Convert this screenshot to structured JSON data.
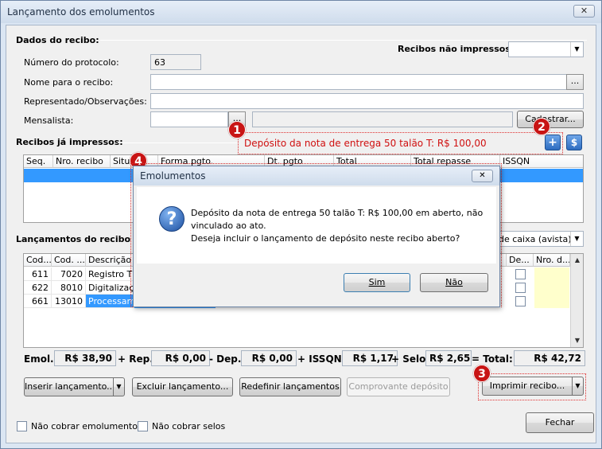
{
  "window": {
    "title": "Lançamento dos emolumentos",
    "close_glyph": "✕"
  },
  "dados_recibo": {
    "section_title": "Dados do recibo:",
    "nao_impressos_label": "Recibos não impressos:",
    "nao_impressos_value": "",
    "protocolo_label": "Número do protocolo:",
    "protocolo_value": "63",
    "nome_label": "Nome para o recibo:",
    "nome_value": "",
    "representado_label": "Representado/Observações:",
    "representado_value": "",
    "mensalista_label": "Mensalista:",
    "mensalista_value": "",
    "mensalista_nome_value": "",
    "ellipsis": "...",
    "cadastrar_label": "Cadastrar..."
  },
  "recibos_impressos": {
    "section_title": "Recibos já impressos:",
    "deposit_notice": "Depósito da nota de entrega 50 talão T: R$ 100,00",
    "add_glyph": "+",
    "money_glyph": "$",
    "columns": [
      "Seq.",
      "Nro. recibo",
      "Situ",
      "Forma pgto.",
      "Dt. pgto",
      "Total",
      "Total repasse",
      "ISSQN"
    ]
  },
  "lancamentos": {
    "section_title": "Lançamentos do recibo (em",
    "forma_pgto_value": "de caixa (avista)",
    "columns": [
      "Cod....",
      "Cod. ...",
      "Descrição",
      "De...",
      "Nro. d..."
    ],
    "rows": [
      {
        "cod1": "611",
        "cod2": "7020",
        "descricao": "Registro TD"
      },
      {
        "cod1": "622",
        "cod2": "8010",
        "descricao": "Digitalização"
      },
      {
        "cod1": "661",
        "cod2": "13010",
        "descricao": "Processame"
      }
    ]
  },
  "totals": {
    "emol_label": "Emol.:",
    "emol_value": "R$ 38,90",
    "rep_label": "+ Rep.:",
    "rep_value": "R$ 0,00",
    "dep_label": "- Dep.:",
    "dep_value": "R$ 0,00",
    "issqn_label": "+ ISSQN:",
    "issqn_value": "R$ 1,17",
    "selo_label": "+ Selo:",
    "selo_value": "R$ 2,65",
    "total_label": "= Total:",
    "total_value": "R$ 42,72"
  },
  "actions": {
    "inserir": "Inserir lançamento...",
    "excluir": "Excluir lançamento...",
    "redefinir": "Redefinir lançamentos",
    "comprovante": "Comprovante depósito",
    "imprimir": "Imprimir recibo...",
    "nao_cobrar_emol": "Não cobrar emolumentos",
    "nao_cobrar_selos": "Não cobrar selos",
    "fechar": "Fechar"
  },
  "badges": {
    "b1": "1",
    "b2": "2",
    "b3": "3",
    "b4": "4"
  },
  "dialog": {
    "title": "Emolumentos",
    "icon_glyph": "?",
    "line1": " Depósito da nota de entrega 50 talão T: R$ 100,00 em aberto, não",
    "line2": "vinculado ao ato.",
    "line3": "Deseja incluir o lançamento de depósito neste recibo aberto?",
    "yes": "Sim",
    "no": "Não"
  },
  "colors": {
    "deposit_text": "#d01010",
    "badge": "#c81414",
    "selection": "#3399ff"
  },
  "icons": {
    "close": "close-icon",
    "dropdown": "chevron-down-icon",
    "question": "question-icon",
    "add": "plus-icon",
    "money": "dollar-icon"
  }
}
